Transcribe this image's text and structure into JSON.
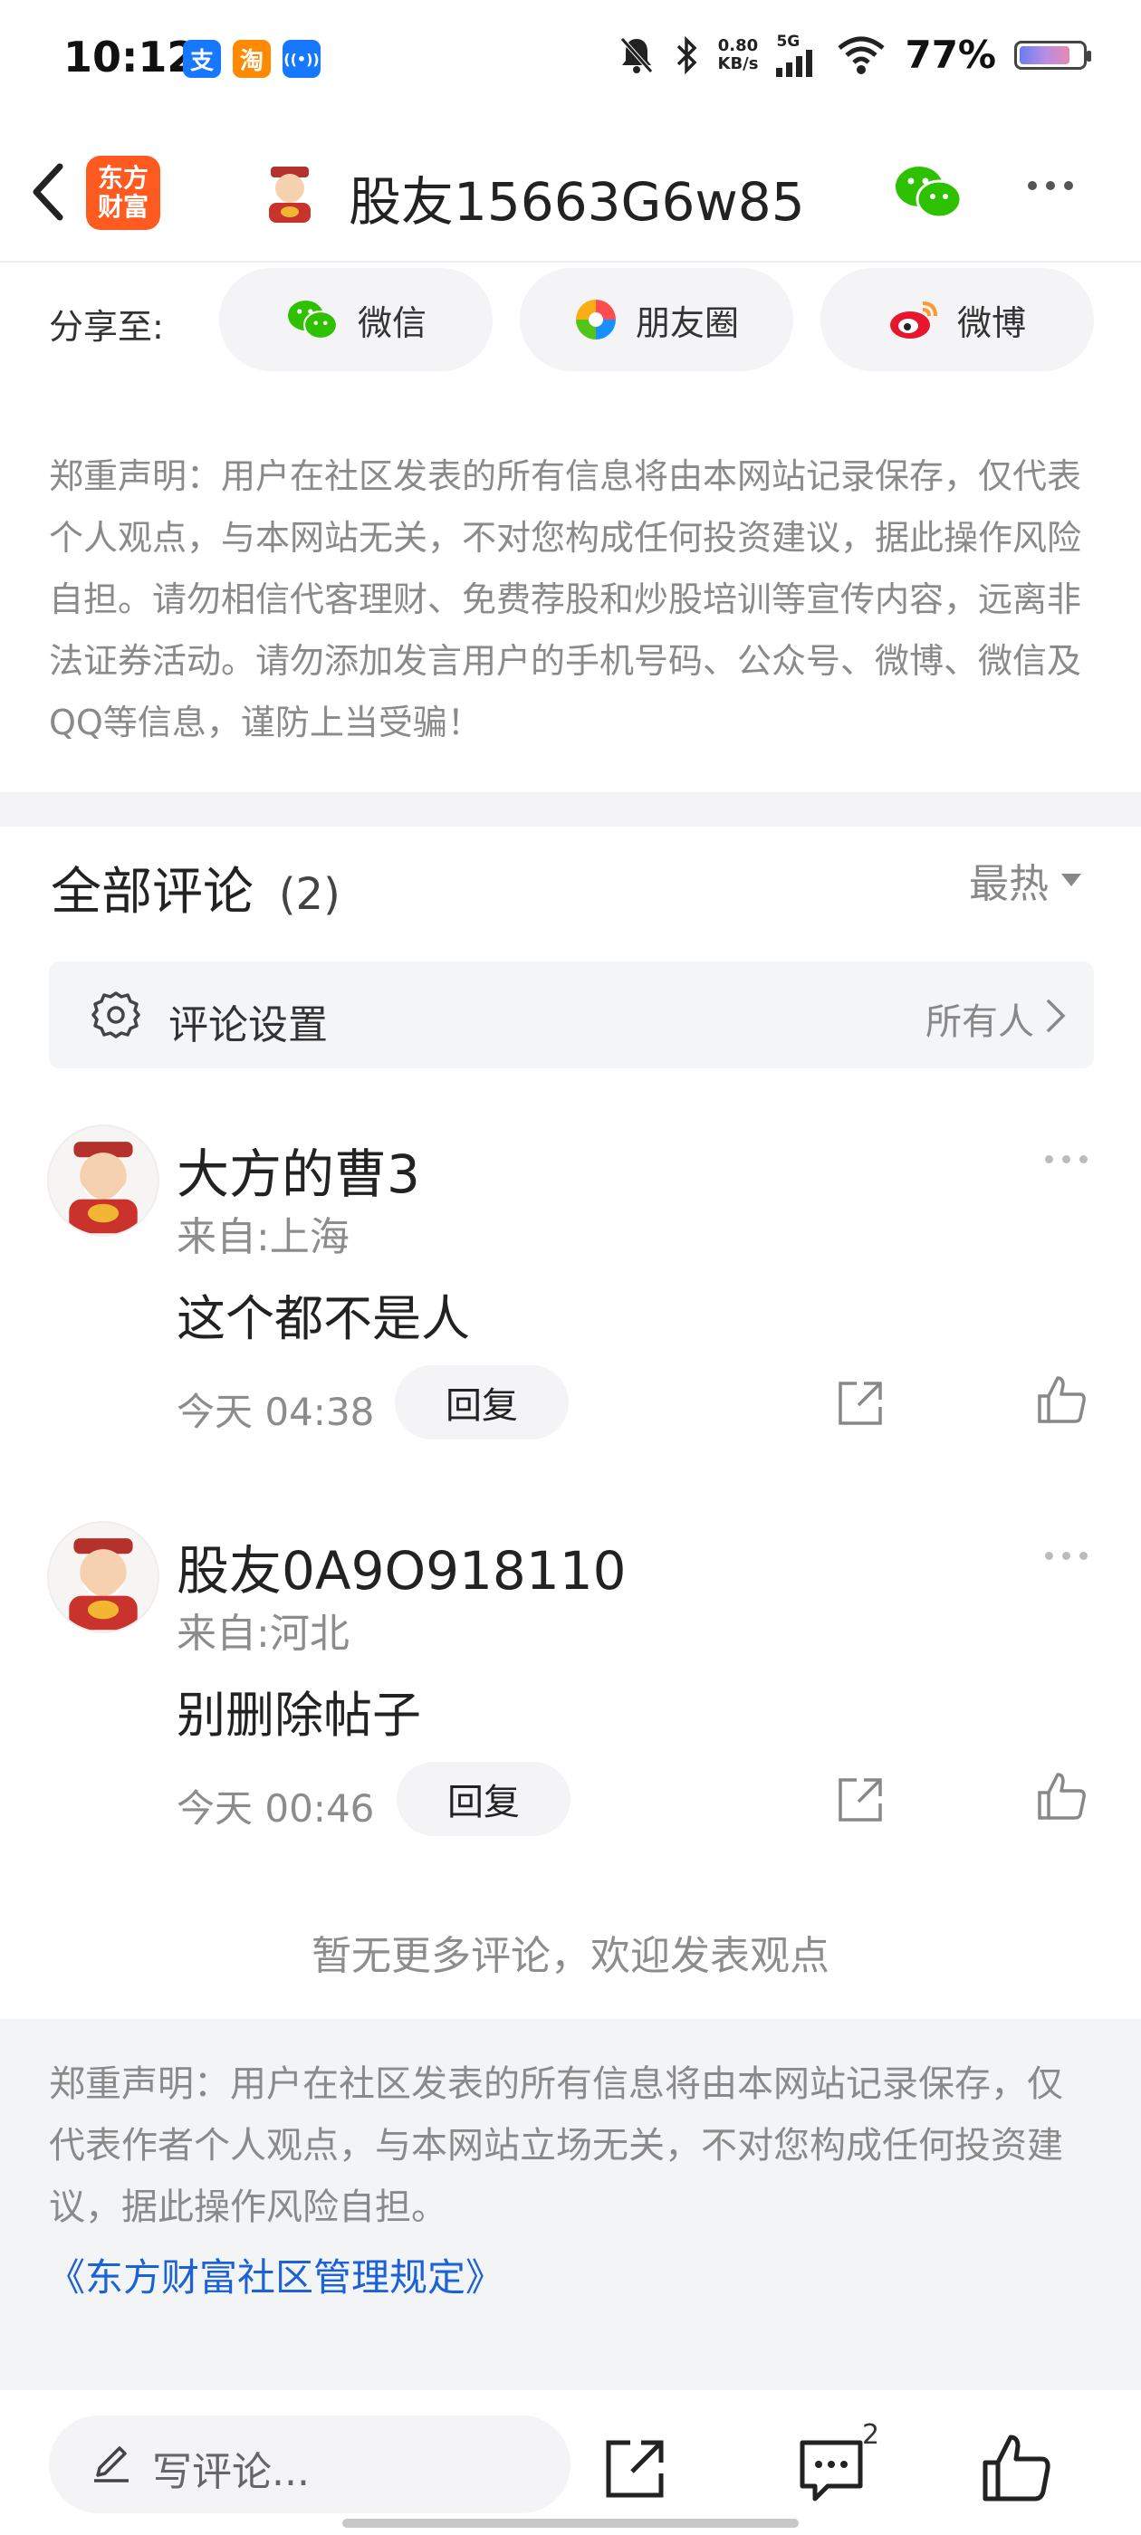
{
  "status_bar": {
    "time": "10:12",
    "apps": [
      {
        "icon": "alipay-icon",
        "glyph": "支",
        "color": "#1677ff"
      },
      {
        "icon": "taobao-icon",
        "glyph": "淘",
        "color": "#ff8a00"
      },
      {
        "icon": "broadcast-icon",
        "glyph": "((•))",
        "color": "#1677ff"
      }
    ],
    "net_speed_value": "0.80",
    "net_speed_unit": "KB/s",
    "network": "5G",
    "battery": "77%"
  },
  "header": {
    "logo_text": "东方财富",
    "title": "股友15663G6w85"
  },
  "share": {
    "label": "分享至:",
    "buttons": [
      {
        "label": "微信",
        "icon": "wechat-icon"
      },
      {
        "label": "朋友圈",
        "icon": "moments-icon"
      },
      {
        "label": "微博",
        "icon": "weibo-icon"
      }
    ]
  },
  "disclaimer_top": "郑重声明：用户在社区发表的所有信息将由本网站记录保存，仅代表个人观点，与本网站无关，不对您构成任何投资建议，据此操作风险自担。请勿相信代客理财、免费荐股和炒股培训等宣传内容，远离非法证券活动。请勿添加发言用户的手机号码、公众号、微博、微信及QQ等信息，谨防上当受骗！",
  "comments_section": {
    "title": "全部评论",
    "count": "(2)",
    "sort": "最热",
    "settings_label": "评论设置",
    "settings_value": "所有人"
  },
  "comments": [
    {
      "name": "大方的曹3",
      "location": "来自:上海",
      "text": "这个都不是人",
      "time": "今天 04:38",
      "reply": "回复"
    },
    {
      "name": "股友0A9O918110",
      "location": "来自:河北",
      "text": "别删除帖子",
      "time": "今天 00:46",
      "reply": "回复"
    }
  ],
  "no_more": "暂无更多评论，欢迎发表观点",
  "disclaimer_bottom": "郑重声明：用户在社区发表的所有信息将由本网站记录保存，仅代表作者个人观点，与本网站立场无关，不对您构成任何投资建议，据此操作风险自担。",
  "rules_link": "《东方财富社区管理规定》",
  "bottom_bar": {
    "compose_placeholder": "写评论...",
    "comment_count": "2"
  }
}
